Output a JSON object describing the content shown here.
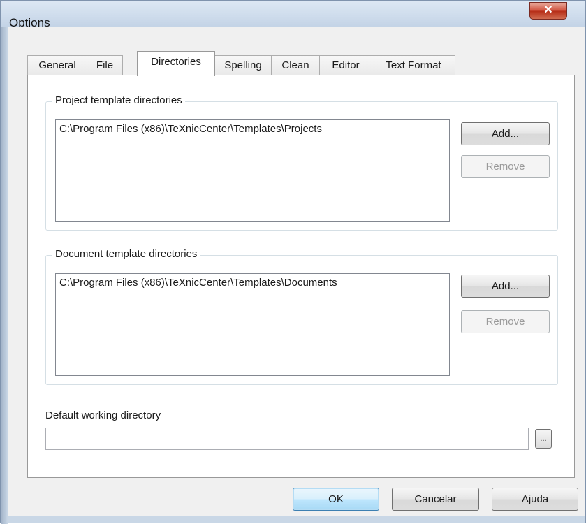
{
  "window": {
    "title": "Options",
    "close_glyph": "✕"
  },
  "tabs": [
    {
      "label": "General"
    },
    {
      "label": "File"
    },
    {
      "label": "Directories"
    },
    {
      "label": "Spelling"
    },
    {
      "label": "Clean"
    },
    {
      "label": "Editor"
    },
    {
      "label": "Text Format"
    }
  ],
  "active_tab": "Directories",
  "project_templates": {
    "label": "Project template directories",
    "items": [
      "C:\\Program Files (x86)\\TeXnicCenter\\Templates\\Projects"
    ],
    "add_label": "Add...",
    "remove_label": "Remove"
  },
  "document_templates": {
    "label": "Document template directories",
    "items": [
      "C:\\Program Files (x86)\\TeXnicCenter\\Templates\\Documents"
    ],
    "add_label": "Add...",
    "remove_label": "Remove"
  },
  "working_directory": {
    "label": "Default working directory",
    "value": "",
    "browse_label": "..."
  },
  "footer": {
    "ok_label": "OK",
    "cancel_label": "Cancelar",
    "help_label": "Ajuda"
  }
}
